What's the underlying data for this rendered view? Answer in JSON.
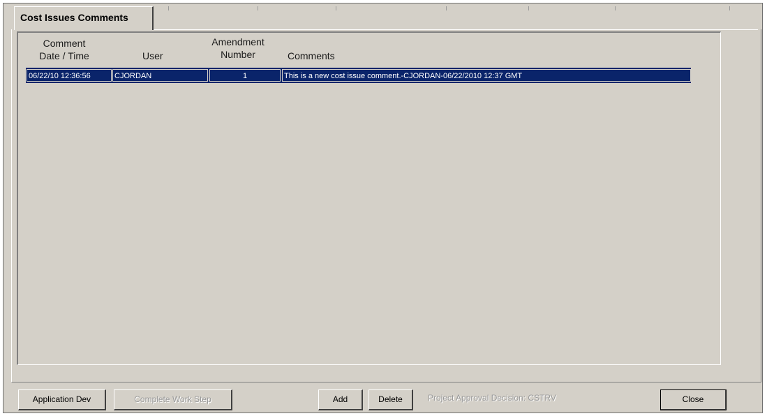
{
  "tab": {
    "label": "Cost Issues Comments"
  },
  "grid": {
    "headers": {
      "datetime_line1": "Comment",
      "datetime_line2": "Date / Time",
      "user": "User",
      "amendment_line1": "Amendment",
      "amendment_line2": "Number",
      "comments": "Comments"
    },
    "rows": [
      {
        "datetime": "06/22/10 12:36:56",
        "user": "CJORDAN",
        "amendment": "1",
        "comment": "This is a new cost issue comment.-CJORDAN-06/22/2010 12:37 GMT"
      }
    ]
  },
  "buttons": {
    "application_dev": "Application Dev",
    "complete_work_step": "Complete Work Step",
    "add": "Add",
    "delete": "Delete",
    "close": "Close"
  },
  "status_text": "Project Approval Decision: CSTRV",
  "colors": {
    "selection": "#0a246a",
    "face": "#d4d0c8"
  }
}
